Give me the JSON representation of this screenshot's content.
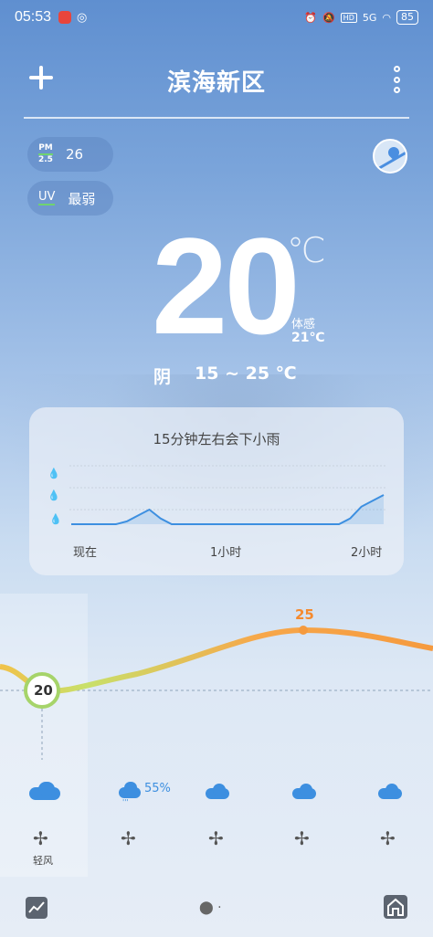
{
  "status_bar": {
    "time": "05:53",
    "app_badge": "小红书",
    "chat_icon": "chat-icon",
    "network": "5G",
    "hd": "HD",
    "battery": "85"
  },
  "header": {
    "city": "滨海新区",
    "add_icon": "plus-icon",
    "more_icon": "more-vertical-icon"
  },
  "air": {
    "pm_label_top": "PM",
    "pm_label_bottom": "2.5",
    "pm_value": "26",
    "uv_label": "UV",
    "uv_value": "最弱"
  },
  "current": {
    "temperature": "20",
    "unit": "℃",
    "feels_label": "体感",
    "feels_value": "21℃",
    "condition": "阴",
    "range": "15 ~ 25 ℃"
  },
  "precipitation": {
    "title": "15分钟左右会下小雨",
    "x_labels": [
      "现在",
      "1小时",
      "2小时"
    ],
    "intensity": [
      0,
      0,
      0,
      0,
      0,
      0.05,
      0.15,
      0.25,
      0.1,
      0,
      0,
      0,
      0,
      0,
      0,
      0,
      0,
      0,
      0,
      0,
      0,
      0,
      0,
      0,
      0,
      0.1,
      0.3,
      0.4,
      0.5
    ]
  },
  "hourly": {
    "now_temp": "20",
    "peak_temp": "25",
    "precip_pct": "55%",
    "wind_label": "轻风",
    "icons": [
      "cloud-icon",
      "rain-cloud-icon",
      "cloud-icon",
      "cloud-icon",
      "cloud-icon"
    ],
    "wind_icons": [
      "fan-icon",
      "fan-icon",
      "fan-icon",
      "fan-icon",
      "fan-icon"
    ]
  },
  "bottom": {
    "trend_icon": "trend-chart-icon",
    "location_icon": "location-pin-icon",
    "home_icon": "home-icon"
  }
}
